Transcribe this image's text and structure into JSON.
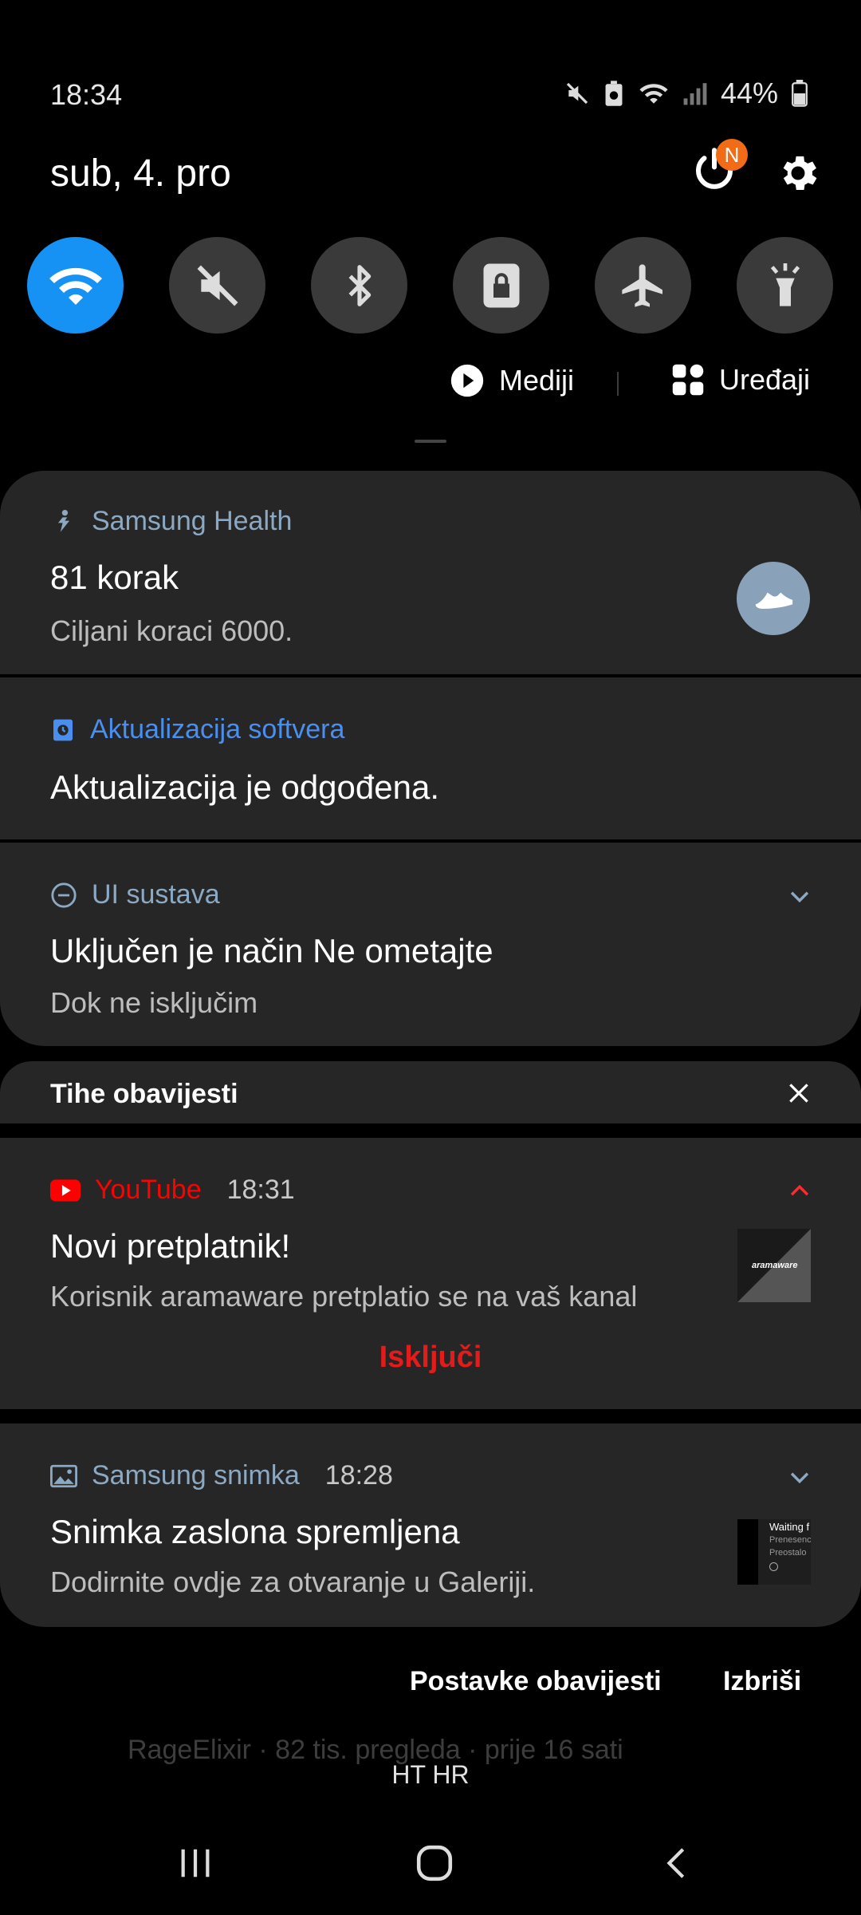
{
  "status_bar": {
    "time": "18:34",
    "battery": "44%",
    "icons": [
      "mute-icon",
      "battery-saver-icon",
      "wifi-icon",
      "signal-icon",
      "battery-icon"
    ]
  },
  "header": {
    "date": "sub, 4. pro",
    "notification_badge": "N"
  },
  "quick_settings": [
    {
      "name": "wifi",
      "icon": "wifi-icon",
      "active": true
    },
    {
      "name": "sound",
      "icon": "mute-icon",
      "active": false
    },
    {
      "name": "bluetooth",
      "icon": "bluetooth-icon",
      "active": false
    },
    {
      "name": "screen-lock",
      "icon": "lock-icon",
      "active": false
    },
    {
      "name": "airplane",
      "icon": "airplane-icon",
      "active": false
    },
    {
      "name": "flashlight",
      "icon": "flashlight-icon",
      "active": false
    }
  ],
  "media_row": {
    "media_label": "Mediji",
    "devices_label": "Uređaji"
  },
  "notifications": {
    "health": {
      "app": "Samsung Health",
      "title": "81 korak",
      "text": "Ciljani koraci 6000."
    },
    "update": {
      "app": "Aktualizacija softvera",
      "title": "Aktualizacija je odgođena."
    },
    "dnd": {
      "app": "UI sustava",
      "title": "Uključen je način Ne ometajte",
      "text": "Dok ne isključim"
    },
    "silent_header": "Tihe obavijesti",
    "youtube": {
      "app": "YouTube",
      "time": "18:31",
      "title": "Novi pretplatnik!",
      "text": "Korisnik aramaware pretplatio se na vaš kanal",
      "action": "Isključi",
      "thumb_text": "aramaware"
    },
    "capture": {
      "app": "Samsung snimka",
      "time": "18:28",
      "title": "Snimka zaslona spremljena",
      "text": "Dodirnite ovdje za otvaranje u Galeriji.",
      "thumb_lines": [
        "Waiting f",
        "Prenesenc",
        "Preostalo"
      ]
    }
  },
  "footer": {
    "settings": "Postavke obavijesti",
    "clear": "Izbriši"
  },
  "background_text": "RageElixir · 82 tis. pregleda · prije 16 sati",
  "carrier": "HT HR",
  "colors": {
    "accent_blue": "#1592f4",
    "youtube_red": "#ff0000",
    "action_red": "#e31b1b",
    "update_blue": "#4a8ff0",
    "card_bg": "#262626"
  }
}
